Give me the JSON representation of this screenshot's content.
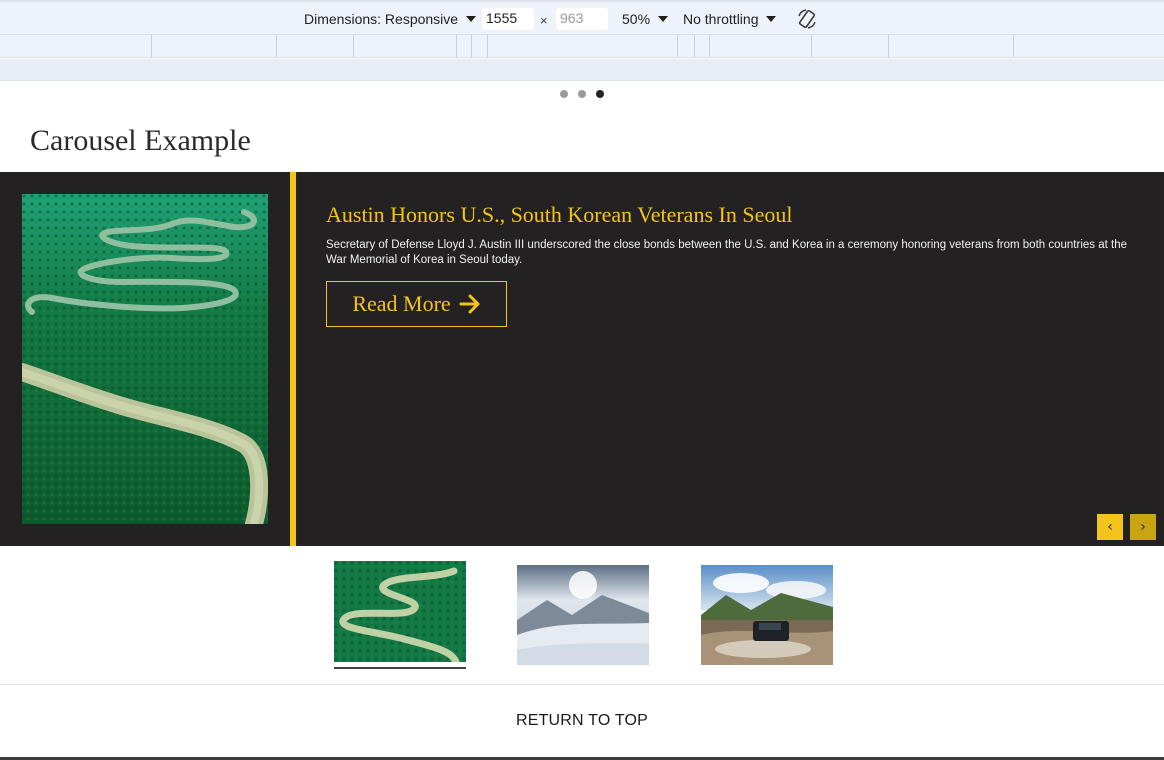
{
  "devtools": {
    "dimensions_label": "Dimensions: Responsive",
    "width_value": "1555",
    "height_placeholder": "963",
    "times_symbol": "×",
    "zoom_label": "50%",
    "throttling_label": "No throttling",
    "rotate_icon": "rotate-icon"
  },
  "page": {
    "title": "Carousel Example",
    "indicator_count": 3,
    "active_indicator": 3
  },
  "slide": {
    "title": "Austin Honors U.S., South Korean Veterans In Seoul",
    "description": "Secretary of Defense Lloyd J. Austin III underscored the close bonds between the U.S. and Korea in a ceremony honoring veterans from both countries at the War Memorial of Korea in Seoul today.",
    "read_more_label": "Read More",
    "image": "river-aerial-image"
  },
  "nav": {
    "prev_label": "‹",
    "next_label": "›"
  },
  "thumbnails": [
    {
      "name": "river-aerial-thumbnail",
      "selected": true
    },
    {
      "name": "snowy-mountain-thumbnail",
      "selected": false
    },
    {
      "name": "jeep-river-crossing-thumbnail",
      "selected": false
    }
  ],
  "footer": {
    "return_to_top_label": "RETURN TO TOP"
  },
  "colors": {
    "accent": "#f4c41a",
    "carousel_bg": "#232122",
    "devtools_bg": "#eef2fb"
  }
}
